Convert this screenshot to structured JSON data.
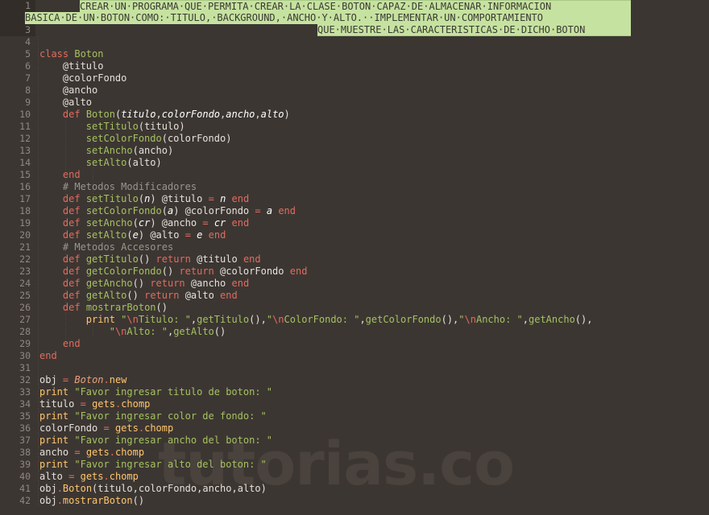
{
  "editor": {
    "language": "Ruby",
    "colors": {
      "background": "#3c3632",
      "gutter_background": "#3c3632",
      "gutter_selected_background": "#332d2a",
      "line_number": "#8f8880",
      "selection_background": "#c6e2a0",
      "selection_text": "#3a3a32",
      "keyword": "#e06c60",
      "class_name": "#a5c261",
      "string": "#a5c261",
      "comment": "#9b948d",
      "constant": "#e8a07a",
      "method_call": "#ffc66d",
      "default_text": "#e6e1dc",
      "watermark": "#4a423d"
    }
  },
  "watermark": {
    "text": "tutorias.co"
  },
  "gutter": {
    "line_numbers": [
      "1",
      "2",
      "3",
      "4",
      "5",
      "6",
      "7",
      "8",
      "9",
      "10",
      "11",
      "12",
      "13",
      "14",
      "15",
      "16",
      "17",
      "18",
      "19",
      "20",
      "21",
      "22",
      "23",
      "24",
      "25",
      "26",
      "27",
      "28",
      "29",
      "30",
      "31",
      "32",
      "33",
      "34",
      "35",
      "36",
      "37",
      "38",
      "39",
      "40",
      "41",
      "42"
    ],
    "selected_line_numbers": [
      "1",
      "2",
      "3"
    ]
  },
  "selection": {
    "lines": [
      "CREAR UN PROGRAMA QUE PERMITA CREAR LA CLASE BOTON CAPAZ DE ALMACENAR INFORMACION",
      "BASICA DE UN BOTON COMO: TITULO, BACKGROUND, ANCHO Y ALTO.  IMPLEMENTAR UN COMPORTAMIENTO",
      "QUE MUESTRE LAS CARACTERISTICAS DE DICHO BOTON"
    ]
  },
  "code": {
    "lines": [
      {
        "n": 1,
        "text": ""
      },
      {
        "n": 2,
        "text": ""
      },
      {
        "n": 3,
        "text": ""
      },
      {
        "n": 4,
        "text": ""
      },
      {
        "n": 5,
        "text": "class Boton"
      },
      {
        "n": 6,
        "text": "    @titulo"
      },
      {
        "n": 7,
        "text": "    @colorFondo"
      },
      {
        "n": 8,
        "text": "    @ancho"
      },
      {
        "n": 9,
        "text": "    @alto"
      },
      {
        "n": 10,
        "text": "    def Boton(titulo,colorFondo,ancho,alto)"
      },
      {
        "n": 11,
        "text": "        setTitulo(titulo)"
      },
      {
        "n": 12,
        "text": "        setColorFondo(colorFondo)"
      },
      {
        "n": 13,
        "text": "        setAncho(ancho)"
      },
      {
        "n": 14,
        "text": "        setAlto(alto)"
      },
      {
        "n": 15,
        "text": "    end"
      },
      {
        "n": 16,
        "text": "    # Metodos Modificadores"
      },
      {
        "n": 17,
        "text": "    def setTitulo(n) @titulo = n end"
      },
      {
        "n": 18,
        "text": "    def setColorFondo(a) @colorFondo = a end"
      },
      {
        "n": 19,
        "text": "    def setAncho(cr) @ancho = cr end"
      },
      {
        "n": 20,
        "text": "    def setAlto(e) @alto = e end"
      },
      {
        "n": 21,
        "text": "    # Metodos Accesores"
      },
      {
        "n": 22,
        "text": "    def getTitulo() return @titulo end"
      },
      {
        "n": 23,
        "text": "    def getColorFondo() return @colorFondo end"
      },
      {
        "n": 24,
        "text": "    def getAncho() return @ancho end"
      },
      {
        "n": 25,
        "text": "    def getAlto() return @alto end"
      },
      {
        "n": 26,
        "text": "    def mostrarBoton()"
      },
      {
        "n": 27,
        "text": "        print \"\\nTitulo: \",getTitulo(),\"\\nColorFondo: \",getColorFondo(),\"\\nAncho: \",getAncho(),"
      },
      {
        "n": 28,
        "text": "            \"\\nAlto: \",getAlto()"
      },
      {
        "n": 29,
        "text": "    end"
      },
      {
        "n": 30,
        "text": "end"
      },
      {
        "n": 31,
        "text": ""
      },
      {
        "n": 32,
        "text": "obj = Boton.new"
      },
      {
        "n": 33,
        "text": "print \"Favor ingresar titulo de boton: \""
      },
      {
        "n": 34,
        "text": "titulo = gets.chomp"
      },
      {
        "n": 35,
        "text": "print \"Favor ingresar color de fondo: \""
      },
      {
        "n": 36,
        "text": "colorFondo = gets.chomp"
      },
      {
        "n": 37,
        "text": "print \"Favor ingresar ancho del boton: \""
      },
      {
        "n": 38,
        "text": "ancho = gets.chomp"
      },
      {
        "n": 39,
        "text": "print \"Favor ingresar alto del boton: \""
      },
      {
        "n": 40,
        "text": "alto = gets.chomp"
      },
      {
        "n": 41,
        "text": "obj.Boton(titulo,colorFondo,ancho,alto)"
      },
      {
        "n": 42,
        "text": "obj.mostrarBoton()"
      }
    ]
  }
}
